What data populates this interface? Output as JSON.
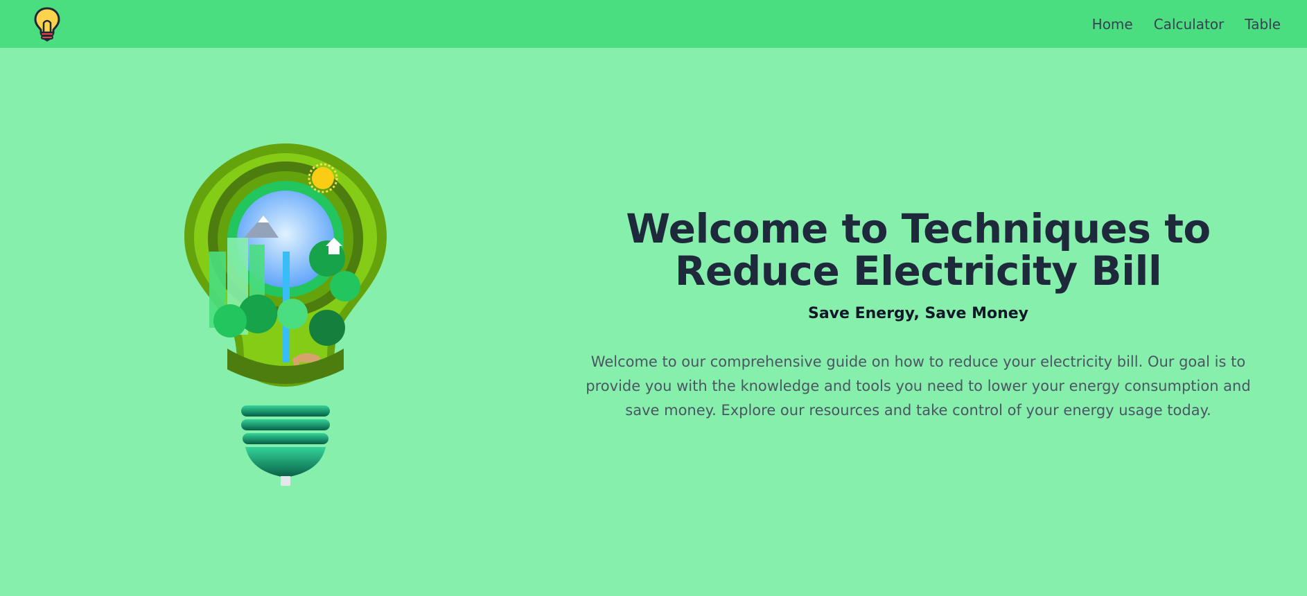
{
  "nav": {
    "logo_icon": "lightbulb-icon",
    "links": [
      {
        "label": "Home"
      },
      {
        "label": "Calculator"
      },
      {
        "label": "Table"
      }
    ]
  },
  "hero": {
    "image_icon": "eco-lightbulb-illustration",
    "title": "Welcome to Techniques to Reduce Electricity Bill",
    "subtitle": "Save Energy, Save Money",
    "body": "Welcome to our comprehensive guide on how to reduce your electricity bill. Our goal is to provide you with the knowledge and tools you need to lower your energy consumption and save money. Explore our resources and take control of your energy usage today."
  },
  "colors": {
    "page_background": "#86efac",
    "navbar_background": "#4ade80",
    "title_color": "#1e293b",
    "body_color": "#4b5563"
  }
}
